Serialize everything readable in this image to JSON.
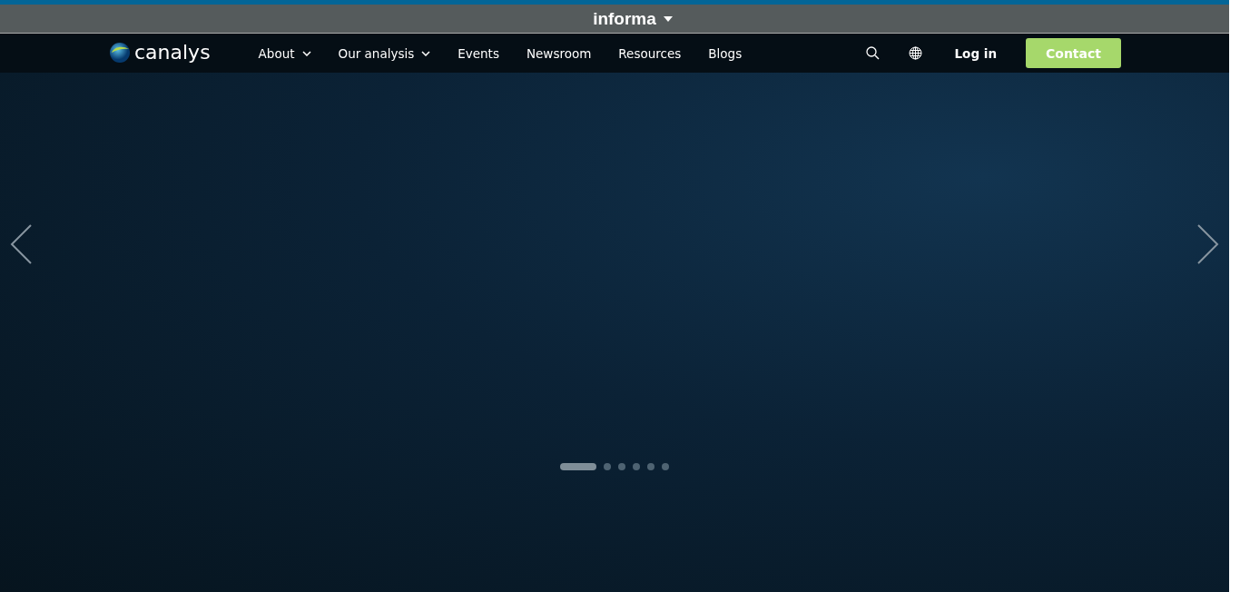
{
  "top_bar": {
    "brand": "informa"
  },
  "header": {
    "logo": "canalys",
    "nav": [
      {
        "label": "About",
        "dropdown": true
      },
      {
        "label": "Our analysis",
        "dropdown": true
      },
      {
        "label": "Events",
        "dropdown": false
      },
      {
        "label": "Newsroom",
        "dropdown": false
      },
      {
        "label": "Resources",
        "dropdown": false
      },
      {
        "label": "Blogs",
        "dropdown": false
      }
    ],
    "login": "Log in",
    "contact": "Contact"
  },
  "carousel": {
    "slides": [
      {
        "selected": true
      },
      {
        "selected": false
      },
      {
        "selected": false
      },
      {
        "selected": false
      },
      {
        "selected": false
      },
      {
        "selected": false
      }
    ]
  }
}
